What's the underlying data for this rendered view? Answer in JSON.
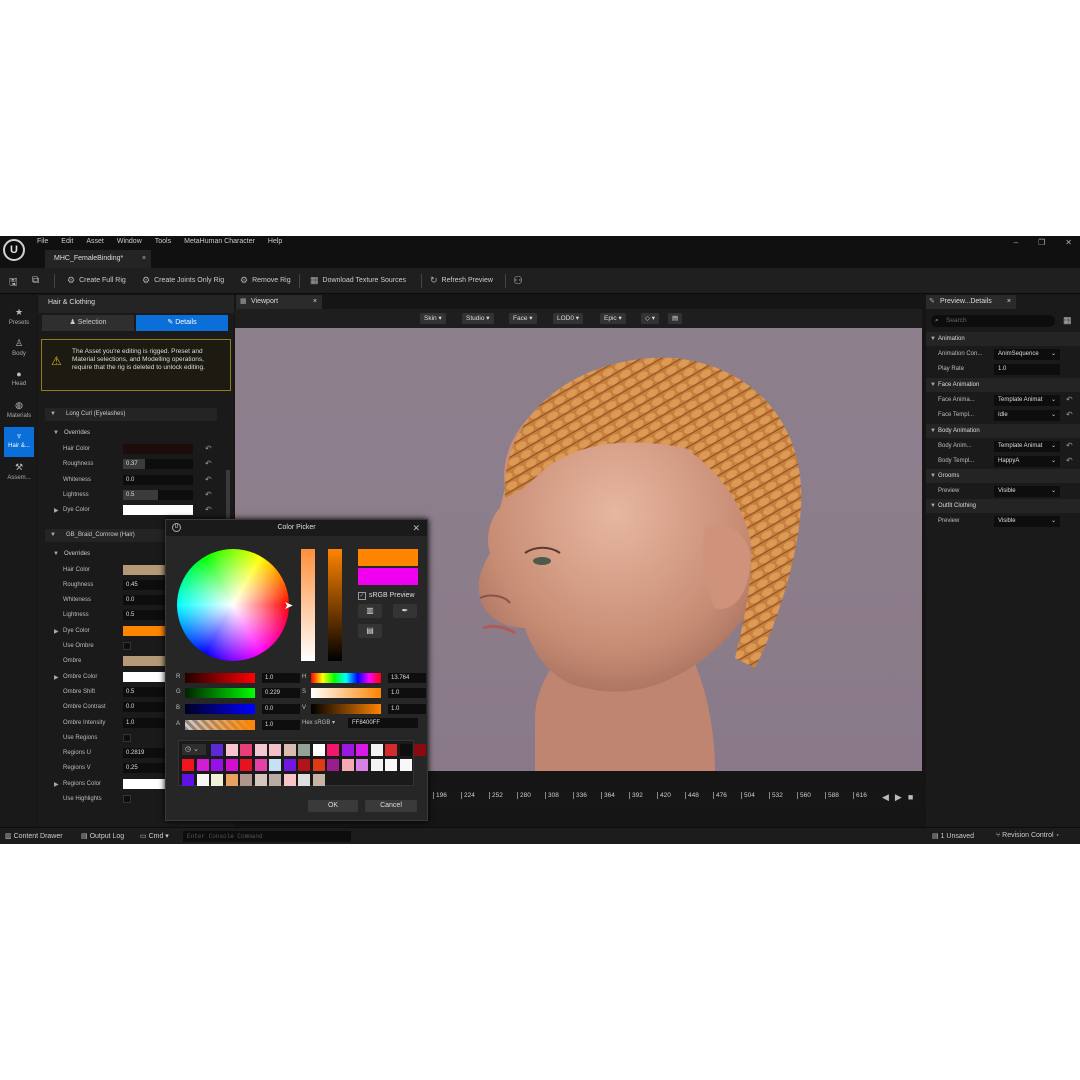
{
  "menubar": {
    "items": [
      "File",
      "Edit",
      "Asset",
      "Window",
      "Tools",
      "MetaHuman Character",
      "Help"
    ],
    "logo": "U"
  },
  "window_controls": {
    "minimize": "–",
    "restore": "❐",
    "close": "✕"
  },
  "document_tab": {
    "title": "MHC_FemaleBinding*",
    "close": "×"
  },
  "toolbar": {
    "create_full_rig": "Create Full Rig",
    "create_joints_rig": "Create Joints Only Rig",
    "remove_rig": "Remove Rig",
    "download_textures": "Download Texture Sources",
    "refresh_preview": "Refresh Preview"
  },
  "left_nav": [
    {
      "label": "Presets",
      "icon": "star-icon",
      "glyph": "★"
    },
    {
      "label": "Body",
      "icon": "body-icon",
      "glyph": "♙"
    },
    {
      "label": "Head",
      "icon": "head-icon",
      "glyph": "●"
    },
    {
      "label": "Materials",
      "icon": "materials-icon",
      "glyph": "◍"
    },
    {
      "label": "Hair &...",
      "icon": "hair-icon",
      "glyph": "♆",
      "active": true
    },
    {
      "label": "Assem...",
      "icon": "assembly-icon",
      "glyph": "⚒"
    }
  ],
  "left_panel": {
    "title": "Hair & Clothing",
    "selection_tab": "Selection",
    "details_tab": "Details",
    "warning": "The Asset you're editing is rigged. Preset and Material selections, and Modelling operations, require that the rig is deleted to unlock editing.",
    "groom1": {
      "name": "Long Curl (Eyelashes)",
      "overrides": "Overrides",
      "rows": [
        {
          "label": "Hair Color",
          "value": "",
          "color": "#1c0c0a",
          "pct": 0
        },
        {
          "label": "Roughness",
          "value": "0.37",
          "pct": 0.32
        },
        {
          "label": "Whiteness",
          "value": "0.0",
          "pct": 0
        },
        {
          "label": "Lightness",
          "value": "0.5",
          "pct": 0.5
        },
        {
          "label": "Dye Color",
          "value": "",
          "color": "#ffffff"
        }
      ]
    },
    "groom2": {
      "name": "GB_Braid_Cornrow (Hair)",
      "overrides": "Overrides",
      "rows": [
        {
          "label": "Hair Color",
          "value": "",
          "color": "#b49a78"
        },
        {
          "label": "Roughness",
          "value": "0.45"
        },
        {
          "label": "Whiteness",
          "value": "0.0"
        },
        {
          "label": "Lightness",
          "value": "0.5"
        },
        {
          "label": "Dye Color",
          "value": "",
          "color": "#ff8400"
        },
        {
          "label": "Use Ombre",
          "value": ""
        },
        {
          "label": "Ombre",
          "value": "",
          "color": "#b49a78"
        },
        {
          "label": "Ombre Color",
          "value": "",
          "color": "#ffffff"
        },
        {
          "label": "Ombre Shift",
          "value": "0.5"
        },
        {
          "label": "Ombre Contrast",
          "value": "0.0"
        },
        {
          "label": "Ombre Intensity",
          "value": "1.0"
        },
        {
          "label": "Use Regions",
          "value": ""
        },
        {
          "label": "Regions U",
          "value": "0.2819"
        },
        {
          "label": "Regions V",
          "value": "0.25"
        },
        {
          "label": "Regions Color",
          "value": "",
          "color": "#ffffff"
        },
        {
          "label": "Use Highlights",
          "value": ""
        }
      ]
    }
  },
  "viewport": {
    "tab": "Viewport",
    "close": "×",
    "buttons": [
      "Skin ▾",
      "Studio ▾",
      "Face ▾",
      "LOD0 ▾",
      "Epic ▾",
      "◇ ▾",
      "▤"
    ],
    "timeline_ticks": [
      "196",
      "224",
      "252",
      "280",
      "308",
      "336",
      "364",
      "392",
      "420",
      "448",
      "476",
      "504",
      "532",
      "560",
      "588",
      "616"
    ],
    "transport": [
      "◀",
      "▶",
      "■"
    ]
  },
  "color_picker": {
    "title": "Color Picker",
    "close": "✕",
    "srgb_preview": "sRGB Preview",
    "r": "1.0",
    "g": "0.229",
    "b": "0.0",
    "a": "1.0",
    "h": "13.764",
    "s": "1.0",
    "v": "1.0",
    "hex_label": "Hex sRGB ▾",
    "hex_value": "FF8400FF",
    "ok": "OK",
    "cancel": "Cancel",
    "palette": [
      "#5b2ad6",
      "#f7c4d0",
      "#e83f7a",
      "#f4c8d2",
      "#f4c0c8",
      "#dcbcb0",
      "#92a398",
      "#ffffff",
      "#f0186a",
      "#9a19e0",
      "#d51ae6",
      "#f3f1f1",
      "#d42c2c",
      "#0e0e0e",
      "#8a0a10",
      "#f1141d",
      "#d21cd6",
      "#9a0fe7",
      "#d20fd0",
      "#e51221",
      "#e53fa8",
      "#c7e1f4",
      "#6e18e1",
      "#b21318",
      "#e13912",
      "#9a1d8f",
      "#f4a9b5",
      "#d881e4",
      "#f4f4f4",
      "#f8f8f8",
      "#f8f8f8",
      "#5e13e3",
      "#f7f7f7",
      "#f0f2d6",
      "#e8a161",
      "#af958c",
      "#d5c6bd",
      "#b9aba4",
      "#f9c4c8",
      "#dedede",
      "#c8b4a4"
    ]
  },
  "right_panel": {
    "tab": "Preview...Details",
    "close": "×",
    "search_placeholder": "Search",
    "sections": {
      "animation": "Animation",
      "face_animation": "Face Animation",
      "body_animation": "Body Animation",
      "grooms": "Grooms",
      "outfit_clothing": "Outfit Clothing"
    },
    "anim_con_label": "Animation Con...",
    "anim_con_value": "AnimSequence",
    "play_rate_label": "Play Rate",
    "play_rate_value": "1.0",
    "face_anim_label": "Face Anima...",
    "face_anim_value": "Template Animat",
    "face_templ_label": "Face Templ...",
    "face_templ_value": "Idle",
    "body_anim_label": "Body Anim...",
    "body_anim_value": "Template Animat",
    "body_templ_label": "Body Templ...",
    "body_templ_value": "HappyA",
    "grooms_preview_label": "Preview",
    "grooms_preview_value": "Visible",
    "outfit_preview_label": "Preview",
    "outfit_preview_value": "Visible"
  },
  "statusbar": {
    "content_drawer": "Content Drawer",
    "output_log": "Output Log",
    "cmd": "Cmd ▾",
    "console_placeholder": "Enter Console Command",
    "unsaved": "1 Unsaved",
    "revision_control": "Revision Control ▾"
  }
}
